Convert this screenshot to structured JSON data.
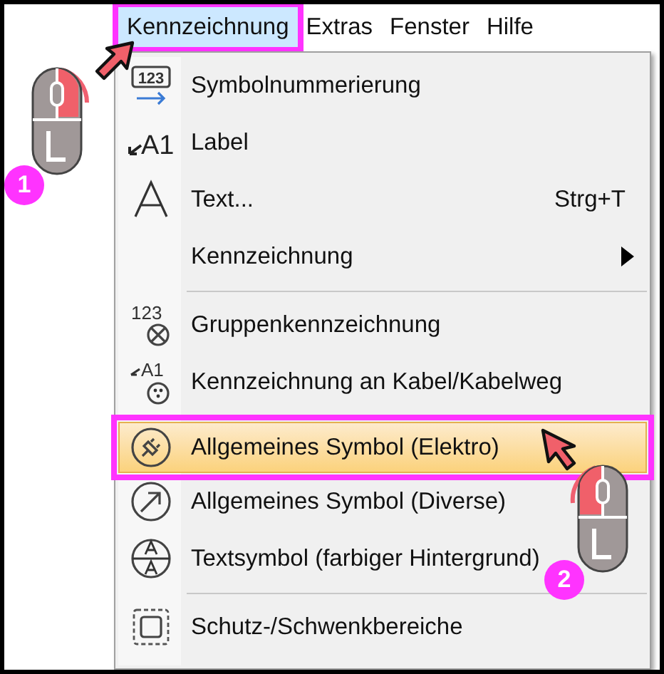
{
  "menu_bar": [
    {
      "label": "Kennzeichnung",
      "selected": true
    },
    {
      "label": "Extras",
      "selected": false
    },
    {
      "label": "Fenster",
      "selected": false
    },
    {
      "label": "Hilfe",
      "selected": false
    }
  ],
  "dropdown": [
    {
      "kind": "item",
      "label": "Symbolnummerierung",
      "icon_text": "123",
      "selected": false
    },
    {
      "kind": "item",
      "label": "Label",
      "icon_text": "A1",
      "selected": false
    },
    {
      "kind": "item",
      "label": "Text...",
      "shortcut": "Strg+T",
      "selected": false
    },
    {
      "kind": "submenu",
      "label": "Kennzeichnung",
      "selected": false
    },
    {
      "kind": "separator"
    },
    {
      "kind": "item",
      "label": "Gruppenkennzeichnung",
      "icon_text": "123",
      "selected": false
    },
    {
      "kind": "item",
      "label": "Kennzeichnung an Kabel/Kabelweg",
      "icon_text": "A1",
      "selected": false
    },
    {
      "kind": "item",
      "label": "Allgemeines Symbol (Elektro)",
      "selected": true
    },
    {
      "kind": "item",
      "label": "Allgemeines Symbol (Diverse)",
      "selected": false
    },
    {
      "kind": "item",
      "label": "Textsymbol (farbiger Hintergrund)",
      "selected": false
    },
    {
      "kind": "separator"
    },
    {
      "kind": "item",
      "label": "Schutz-/Schwenkbereiche",
      "selected": false
    }
  ],
  "steps": [
    {
      "number": "1"
    },
    {
      "number": "2"
    }
  ]
}
